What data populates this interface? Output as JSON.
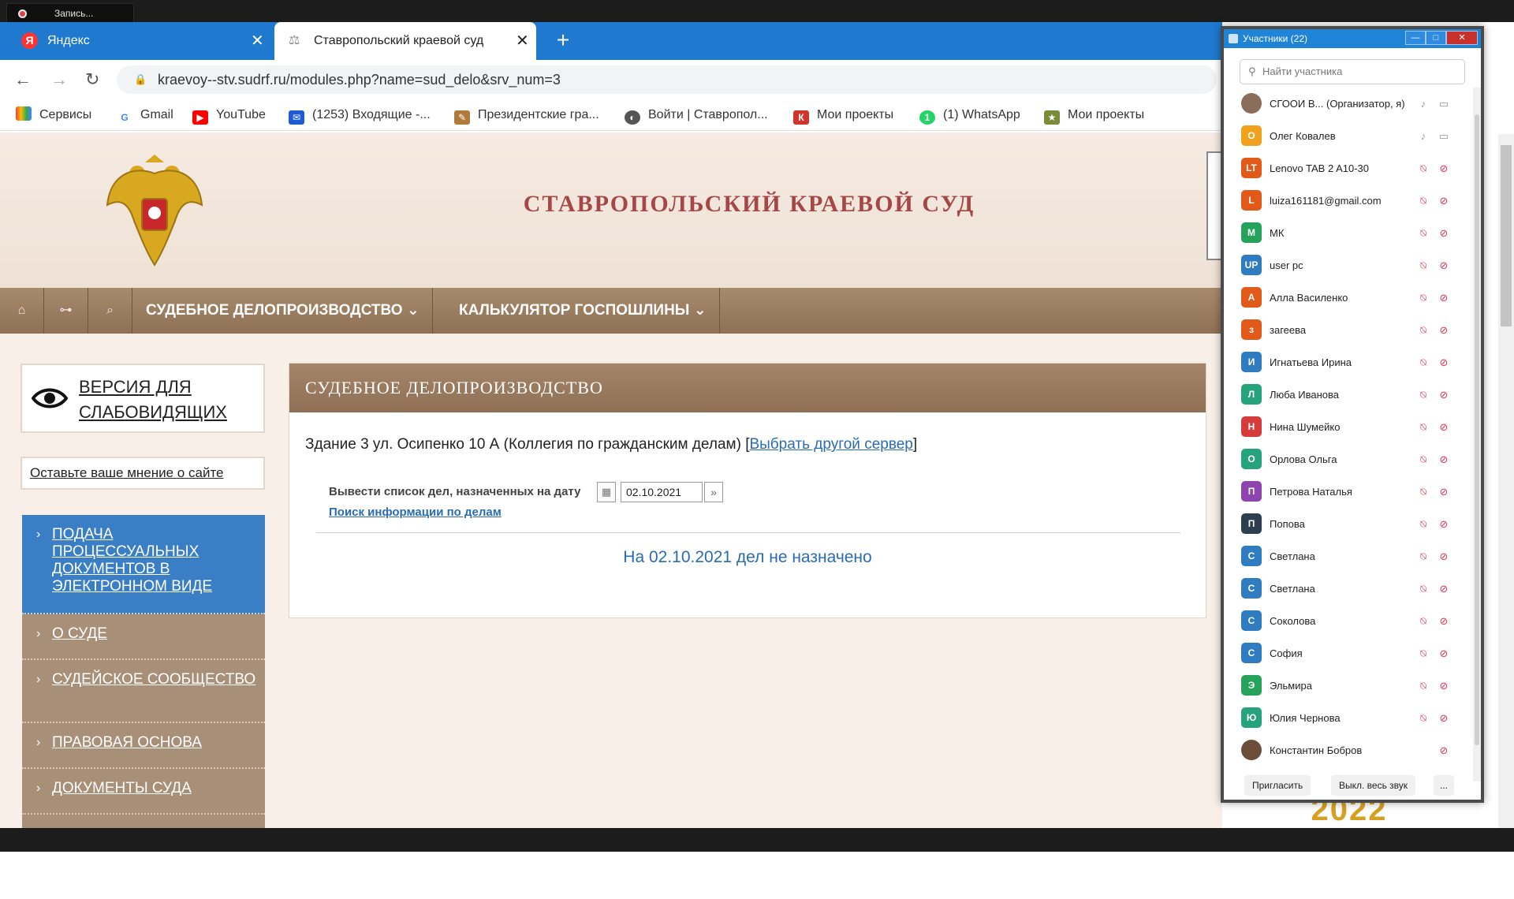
{
  "recording": {
    "label": "Запись..."
  },
  "browser": {
    "tabs": [
      {
        "label": "Яндекс",
        "icon_letter": "Я"
      },
      {
        "label": "Ставропольский краевой суд"
      }
    ],
    "url": "kraevoy--stv.sudrf.ru/modules.php?name=sud_delo&srv_num=3",
    "bookmarks": [
      {
        "label": "Сервисы",
        "icon": "apps-grid-icon"
      },
      {
        "label": "Gmail",
        "icon": "google-icon"
      },
      {
        "label": "YouTube",
        "icon": "youtube-icon"
      },
      {
        "label": "(1253) Входящие -...",
        "icon": "mail-icon"
      },
      {
        "label": "Президентские гра...",
        "icon": "grants-icon"
      },
      {
        "label": "Войти | Ставропол...",
        "icon": "globe-icon"
      },
      {
        "label": "Мои проекты",
        "icon": "projects-icon"
      },
      {
        "label": "(1) WhatsApp",
        "icon": "whatsapp-icon"
      },
      {
        "label": "Мои проекты",
        "icon": "projects-icon"
      }
    ]
  },
  "site": {
    "title": "СТАВРОПОЛЬСКИЙ КРАЕВОЙ СУД",
    "menu": [
      {
        "label": "СУДЕБНОЕ ДЕЛОПРОИЗВОДСТВО ⌄"
      },
      {
        "label": "КАЛЬКУЛЯТОР ГОСПОШЛИНЫ ⌄"
      }
    ],
    "vision_line1": "ВЕРСИЯ ДЛЯ",
    "vision_line2": "СЛАБОВИДЯЩИХ",
    "opinion": "Оставьте ваше мнение о сайте",
    "sidebar": [
      {
        "label": "ПОДАЧА ПРОЦЕССУАЛЬНЫХ ДОКУМЕНТОВ В ЭЛЕКТРОННОМ ВИДЕ"
      },
      {
        "label": "О СУДЕ"
      },
      {
        "label": "СУДЕЙСКОЕ СООБЩЕСТВО"
      },
      {
        "label": "ПРАВОВАЯ ОСНОВА"
      },
      {
        "label": "ДОКУМЕНТЫ СУДА"
      }
    ],
    "content": {
      "heading": "СУДЕБНОЕ ДЕЛОПРОИЗВОДСТВО",
      "building": "Здание 3 ул. Осипенко 10 А (Коллегия по гражданским делам) [",
      "change_server": "Выбрать другой сервер",
      "building_end": "]",
      "date_label": "Вывести список дел, назначенных на дату",
      "date_value": "02.10.2021",
      "search_link": "Поиск информации по делам",
      "no_results": "На 02.10.2021 дел не назначено"
    },
    "year_logo": "2022"
  },
  "participants": {
    "title": "Участники (22)",
    "search_placeholder": "Найти участника",
    "list": [
      {
        "name": "СГООИ В...  (Организатор, я)",
        "initials": "",
        "color": "#8a6d5a",
        "mic": "on",
        "cam": "on"
      },
      {
        "name": "Олег Ковалев",
        "initials": "О",
        "color": "#f0a21e",
        "mic": "on",
        "cam": "on"
      },
      {
        "name": "Lenovo TAB 2 A10-30",
        "initials": "LT",
        "color": "#e15a1a",
        "mic": "muted",
        "cam": "off"
      },
      {
        "name": "luiza161181@gmail.com",
        "initials": "L",
        "color": "#e15a1a",
        "mic": "muted",
        "cam": "off"
      },
      {
        "name": "МК",
        "initials": "М",
        "color": "#26a35a",
        "mic": "muted",
        "cam": "off"
      },
      {
        "name": "user pc",
        "initials": "UP",
        "color": "#2f7cc0",
        "mic": "muted",
        "cam": "off"
      },
      {
        "name": "Алла Василенко",
        "initials": "А",
        "color": "#e15a1a",
        "mic": "muted",
        "cam": "off"
      },
      {
        "name": "загеева",
        "initials": "з",
        "color": "#e15a1a",
        "mic": "muted",
        "cam": "off"
      },
      {
        "name": "Игнатьева Ирина",
        "initials": "И",
        "color": "#2f7cc0",
        "mic": "muted",
        "cam": "off"
      },
      {
        "name": "Люба Иванова",
        "initials": "Л",
        "color": "#26a37a",
        "mic": "muted",
        "cam": "off"
      },
      {
        "name": "Нина Шумейко",
        "initials": "Н",
        "color": "#d63b3b",
        "mic": "muted",
        "cam": "off"
      },
      {
        "name": "Орлова Ольга",
        "initials": "О",
        "color": "#26a37a",
        "mic": "muted",
        "cam": "off"
      },
      {
        "name": "Петрова Наталья",
        "initials": "П",
        "color": "#8e44ad",
        "mic": "muted",
        "cam": "off"
      },
      {
        "name": "Попова",
        "initials": "П",
        "color": "#2c3e50",
        "mic": "muted",
        "cam": "off"
      },
      {
        "name": "Светлана",
        "initials": "С",
        "color": "#2f7cc0",
        "mic": "muted",
        "cam": "off"
      },
      {
        "name": "Светлана",
        "initials": "С",
        "color": "#2f7cc0",
        "mic": "muted",
        "cam": "off"
      },
      {
        "name": "Соколова",
        "initials": "С",
        "color": "#2f7cc0",
        "mic": "muted",
        "cam": "off"
      },
      {
        "name": "София",
        "initials": "С",
        "color": "#2f7cc0",
        "mic": "muted",
        "cam": "off"
      },
      {
        "name": "Эльмира",
        "initials": "Э",
        "color": "#26a35a",
        "mic": "muted",
        "cam": "off"
      },
      {
        "name": "Юлия Чернова",
        "initials": "Ю",
        "color": "#26a37a",
        "mic": "muted",
        "cam": "off"
      },
      {
        "name": "Константин Бобров",
        "initials": "",
        "color": "#6b4e3a",
        "mic": "none",
        "cam": "off"
      }
    ],
    "invite": "Пригласить",
    "mute_all": "Выкл. весь звук",
    "more": "..."
  }
}
